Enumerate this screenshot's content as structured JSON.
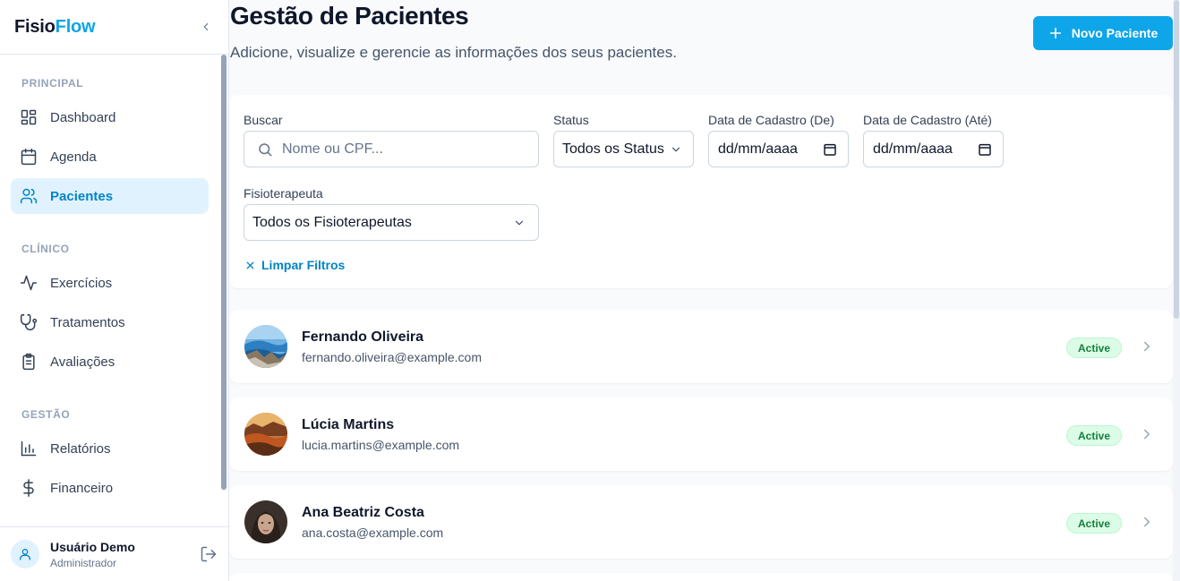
{
  "brand": {
    "part1": "Fisio",
    "part2": "Flow"
  },
  "sidebar": {
    "sections": [
      {
        "title": "PRINCIPAL",
        "items": [
          "Dashboard",
          "Agenda",
          "Pacientes"
        ]
      },
      {
        "title": "CLÍNICO",
        "items": [
          "Exercícios",
          "Tratamentos",
          "Avaliações"
        ]
      },
      {
        "title": "GESTÃO",
        "items": [
          "Relatórios",
          "Financeiro"
        ]
      }
    ],
    "active_item": "Pacientes"
  },
  "user": {
    "name": "Usuário Demo",
    "role": "Administrador"
  },
  "header": {
    "title": "Gestão de Pacientes",
    "subtitle": "Adicione, visualize e gerencie as informações dos seus pacientes.",
    "new_button": "Novo Paciente"
  },
  "filters": {
    "search_label": "Buscar",
    "search_placeholder": "Nome ou CPF...",
    "status_label": "Status",
    "status_value": "Todos os Status",
    "date_from_label": "Data de Cadastro (De)",
    "date_from_value": "dd/mm/aaaa",
    "date_to_label": "Data de Cadastro (Até)",
    "date_to_value": "dd/mm/aaaa",
    "therapist_label": "Fisioterapeuta",
    "therapist_value": "Todos os Fisioterapeutas",
    "clear_label": "Limpar Filtros"
  },
  "patients": [
    {
      "name": "Fernando Oliveira",
      "email": "fernando.oliveira@example.com",
      "status": "Active"
    },
    {
      "name": "Lúcia Martins",
      "email": "lucia.martins@example.com",
      "status": "Active"
    },
    {
      "name": "Ana Beatriz Costa",
      "email": "ana.costa@example.com",
      "status": "Active"
    }
  ],
  "colors": {
    "accent": "#0ea5e9",
    "active_badge_bg": "#dcfce7",
    "active_badge_text": "#15803d"
  }
}
